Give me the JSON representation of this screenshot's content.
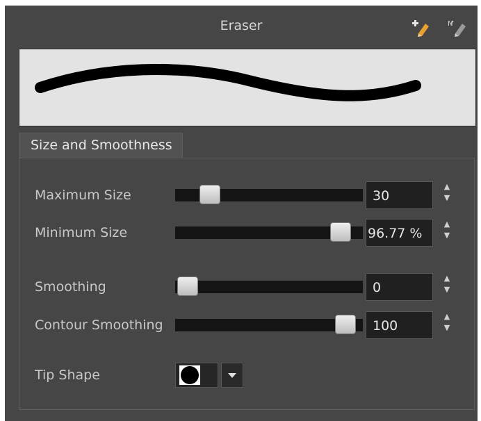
{
  "panel": {
    "title": "Eraser",
    "icons": {
      "new": "new-preset-icon",
      "rename": "rename-preset-icon"
    }
  },
  "tab": {
    "label": "Size and Smoothness"
  },
  "settings": {
    "max_size": {
      "label": "Maximum Size",
      "value": "30",
      "slider_level": 0.17
    },
    "min_size": {
      "label": "Minimum Size",
      "value": "96.77 %",
      "slider_level": 0.9677
    },
    "smoothing": {
      "label": "Smoothing",
      "value": "0",
      "slider_level": 0.0
    },
    "contour_smoothing": {
      "label": "Contour Smoothing",
      "value": "100",
      "slider_level": 1.0
    },
    "tip_shape": {
      "label": "Tip Shape",
      "icon": "round-tip-icon"
    }
  },
  "colors": {
    "panel_bg": "#464646",
    "preview_bg": "#e3e3e3",
    "stroke": "#000000"
  }
}
